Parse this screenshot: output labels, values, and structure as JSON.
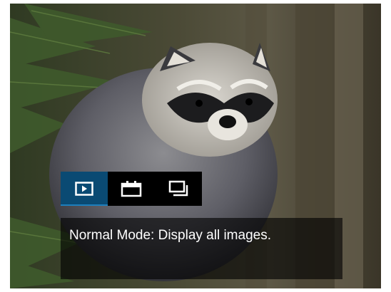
{
  "mode_menu": {
    "selected_index": 0,
    "options": [
      {
        "icon": "play-icon",
        "selected": true
      },
      {
        "icon": "calendar-icon",
        "selected": false
      },
      {
        "icon": "stacked-frames-icon",
        "selected": false
      }
    ],
    "selected_color": "#0a4a73"
  },
  "info_panel": {
    "description": "Normal Mode: Display all images."
  },
  "photo": {
    "subject": "raccoon-photo"
  }
}
